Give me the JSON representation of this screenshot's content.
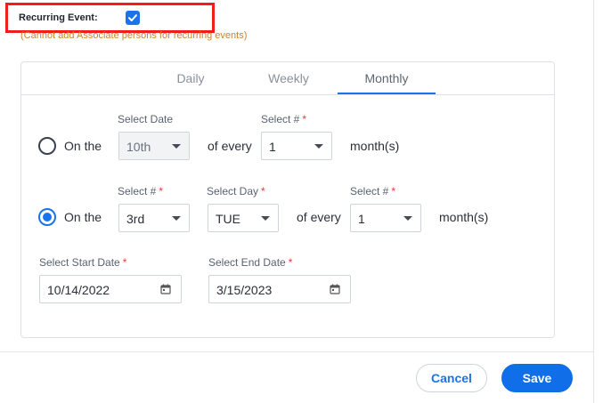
{
  "recurring": {
    "label": "Recurring Event:",
    "checked": true,
    "note": "(Cannot add Associate persons for recurring events)"
  },
  "tabs": [
    {
      "label": "Daily",
      "active": false
    },
    {
      "label": "Weekly",
      "active": false
    },
    {
      "label": "Monthly",
      "active": true
    }
  ],
  "option1": {
    "selected": false,
    "prefix": "On the",
    "date_label": "Select Date",
    "date_value": "10th",
    "of_every": "of every",
    "number_label": "Select #",
    "number_value": "1",
    "suffix": "month(s)"
  },
  "option2": {
    "selected": true,
    "prefix": "On the",
    "ordinal_label": "Select #",
    "ordinal_value": "3rd",
    "day_label": "Select Day",
    "day_value": "TUE",
    "of_every": "of every",
    "number_label": "Select #",
    "number_value": "1",
    "suffix": "month(s)"
  },
  "dates": {
    "start_label": "Select Start Date",
    "start_value": "10/14/2022",
    "end_label": "Select End Date",
    "end_value": "3/15/2023"
  },
  "required_marker": "*",
  "buttons": {
    "cancel": "Cancel",
    "save": "Save"
  },
  "colors": {
    "primary": "#1a73e8",
    "highlight": "#f01d1d",
    "note": "#c8842e",
    "required": "#e53935"
  }
}
